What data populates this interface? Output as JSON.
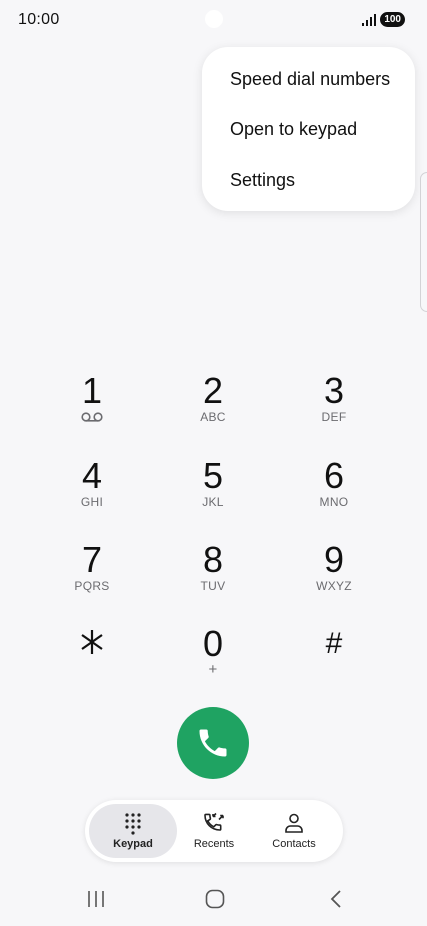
{
  "status_bar": {
    "time": "10:00",
    "battery": "100"
  },
  "overflow_menu": {
    "items": [
      {
        "label": "Speed dial numbers"
      },
      {
        "label": "Open to keypad"
      },
      {
        "label": "Settings"
      }
    ]
  },
  "keypad": {
    "keys": [
      {
        "digit": "1",
        "letters": ""
      },
      {
        "digit": "2",
        "letters": "ABC"
      },
      {
        "digit": "3",
        "letters": "DEF"
      },
      {
        "digit": "4",
        "letters": "GHI"
      },
      {
        "digit": "5",
        "letters": "JKL"
      },
      {
        "digit": "6",
        "letters": "MNO"
      },
      {
        "digit": "7",
        "letters": "PQRS"
      },
      {
        "digit": "8",
        "letters": "TUV"
      },
      {
        "digit": "9",
        "letters": "WXYZ"
      },
      {
        "digit": "*",
        "letters": ""
      },
      {
        "digit": "0",
        "letters": "+"
      },
      {
        "digit": "#",
        "letters": ""
      }
    ]
  },
  "tabs": [
    {
      "label": "Keypad",
      "icon": "dialpad-icon",
      "active": true
    },
    {
      "label": "Recents",
      "icon": "recents-icon",
      "active": false
    },
    {
      "label": "Contacts",
      "icon": "contacts-icon",
      "active": false
    }
  ],
  "colors": {
    "call_button": "#1fa362",
    "background": "#f7f7f9"
  }
}
